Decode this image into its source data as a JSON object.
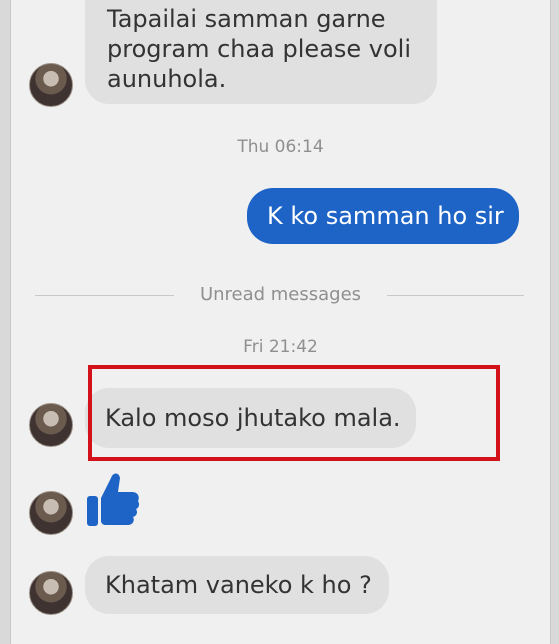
{
  "messages": {
    "m1": "Tapailai samman garne\nprogram chaa please voli\naunuhola.",
    "m2": "K ko samman ho sir",
    "m3": "Kalo moso jhutako mala.",
    "m5": "Khatam vaneko k ho ?"
  },
  "timestamps": {
    "t1": "Thu 06:14",
    "t2": "Fri 21:42"
  },
  "divider": {
    "label": "Unread messages"
  },
  "icons": {
    "like": "thumbs-up-icon"
  },
  "colors": {
    "outgoing_bubble": "#1e63c6",
    "incoming_bubble": "#e0e0e0",
    "highlight_box": "#d3111b",
    "like_icon": "#1e63c6"
  }
}
